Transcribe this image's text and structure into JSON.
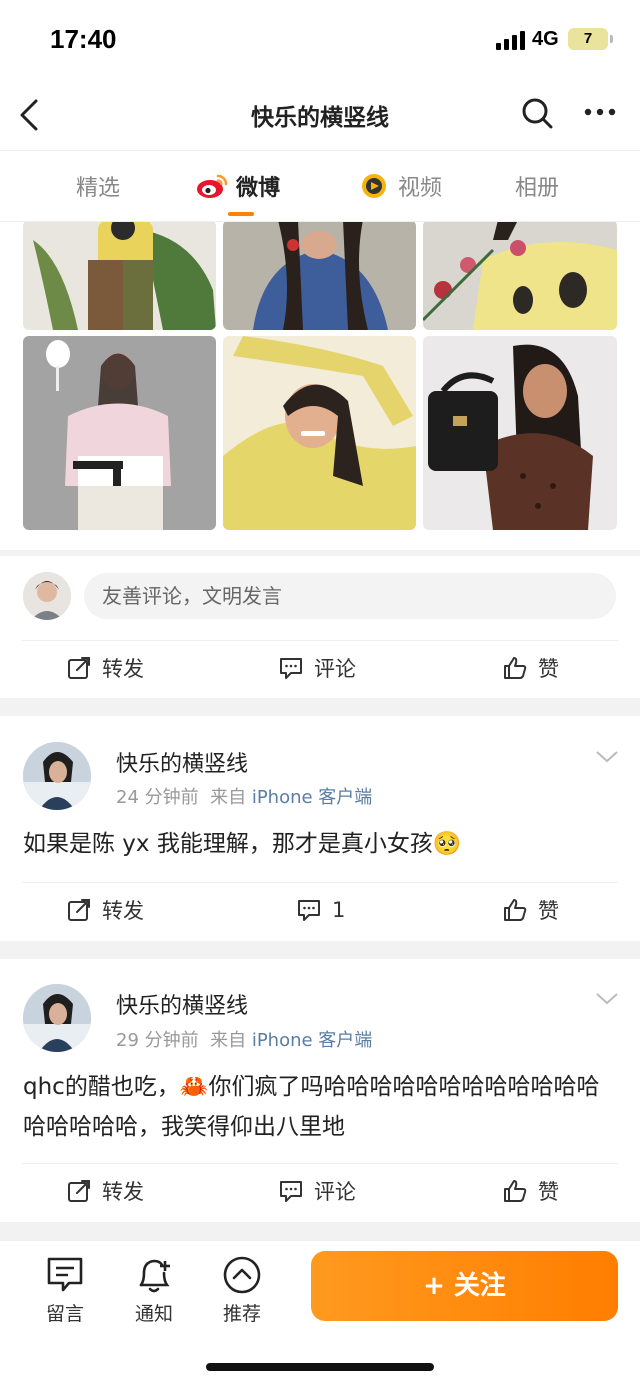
{
  "status_bar": {
    "time": "17:40",
    "network": "4G",
    "battery": "7"
  },
  "nav": {
    "title": "快乐的横竖线"
  },
  "tabs": [
    {
      "label": "精选"
    },
    {
      "label": "微博"
    },
    {
      "label": "视频"
    },
    {
      "label": "相册"
    }
  ],
  "colors": {
    "accent": "#ff8200",
    "link": "#5a7da3",
    "separator": "#f2f2f2"
  },
  "comment_input": {
    "placeholder": "友善评论，文明发言"
  },
  "top_actions": {
    "repost": "转发",
    "comment": "评论",
    "like": "赞"
  },
  "posts": [
    {
      "author": "快乐的横竖线",
      "time": "24 分钟前",
      "source_prefix": "来自",
      "source": "iPhone 客户端",
      "text": "如果是陈 yx 我能理解，那才是真小女孩🥺",
      "repost": "转发",
      "comment": "1",
      "like": "赞"
    },
    {
      "author": "快乐的横竖线",
      "time": "29 分钟前",
      "source_prefix": "来自",
      "source": "iPhone 客户端",
      "text": "qhc的醋也吃，🦀你们疯了吗哈哈哈哈哈哈哈哈哈哈哈哈哈哈哈哈哈，我笑得仰出八里地",
      "repost": "转发",
      "comment": "评论",
      "like": "赞"
    }
  ],
  "bottom_bar": {
    "message": "留言",
    "notify": "通知",
    "recommend": "推荐",
    "follow": "+ 关注"
  }
}
